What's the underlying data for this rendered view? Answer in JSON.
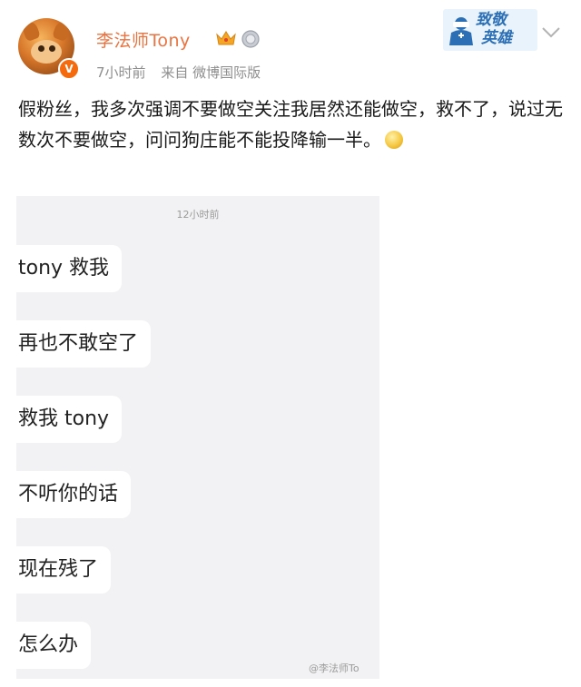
{
  "post": {
    "username": "李法师Tony",
    "time": "7小时前",
    "source": "来自 微博国际版",
    "badge_text_line1": "致敬",
    "badge_text_line2": "英雄",
    "content": "假粉丝，我多次强调不要做空关注我居然还能做空，救不了，说过无数次不要做空，问问狗庄能不能投降输一半。"
  },
  "chat": {
    "timestamp": "12小时前",
    "messages": [
      "tony 救我",
      "再也不敢空了",
      "救我 tony",
      "不听你的话",
      "现在残了",
      "怎么办"
    ],
    "watermark": "@李法师To"
  },
  "colors": {
    "username": "#eb7340",
    "meta": "#8e8e8e",
    "verified_badge": "#f46a0c",
    "chat_bg": "#f2f2f4"
  }
}
